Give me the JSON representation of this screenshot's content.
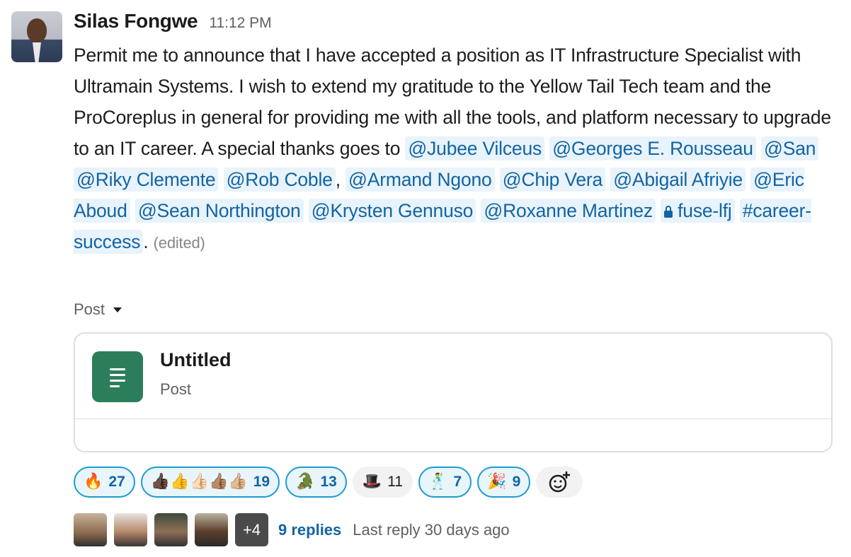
{
  "message": {
    "author": "Silas Fongwe",
    "time": "11:12 PM",
    "text_main": "Permit me to announce that I have accepted a position as IT Infrastructure Specialist with Ultramain Systems. I wish to extend my gratitude to the Yellow Tail Tech  team and the ProCoreplus in general  for providing me with all the tools, and platform necessary to upgrade to an IT career. A special thanks goes to",
    "mentions": [
      "@Jubee Vilceus",
      "@Georges E. Rousseau",
      "@San",
      "@Riky Clemente",
      "@Rob Coble"
    ],
    "comma": ",",
    "mentions2": [
      "@Armand Ngono",
      "@Chip Vera",
      "@Abigail Afriyie",
      "@Eric Aboud",
      "@Sean Northington",
      "@Krysten Gennuso",
      "@Roxanne Martinez"
    ],
    "channel_private": "fuse-lfj",
    "channel": "#career-success",
    "period": ".",
    "edited": "(edited)"
  },
  "post_label": "Post",
  "post_card": {
    "title": "Untitled",
    "subtitle": "Post"
  },
  "reactions": [
    {
      "emoji": "🔥",
      "count": "27",
      "highlighted": true
    },
    {
      "emoji": "👍🏿👍👍🏻👍🏽👍🏼",
      "count": "19",
      "highlighted": true
    },
    {
      "emoji": "🐊",
      "count": "13",
      "highlighted": true
    },
    {
      "emoji": "🎩",
      "count": "11",
      "highlighted": false
    },
    {
      "emoji": "🕺",
      "count": "7",
      "highlighted": true
    },
    {
      "emoji": "🎉",
      "count": "9",
      "highlighted": true
    }
  ],
  "thread": {
    "more_count": "+4",
    "replies": "9 replies",
    "last_reply": "Last reply 30 days ago"
  },
  "colors": {
    "mention_bg": "#e8f3fb",
    "link": "#1264a3",
    "reaction_border": "#1d9bd1",
    "post_icon": "#2c7e5b"
  }
}
